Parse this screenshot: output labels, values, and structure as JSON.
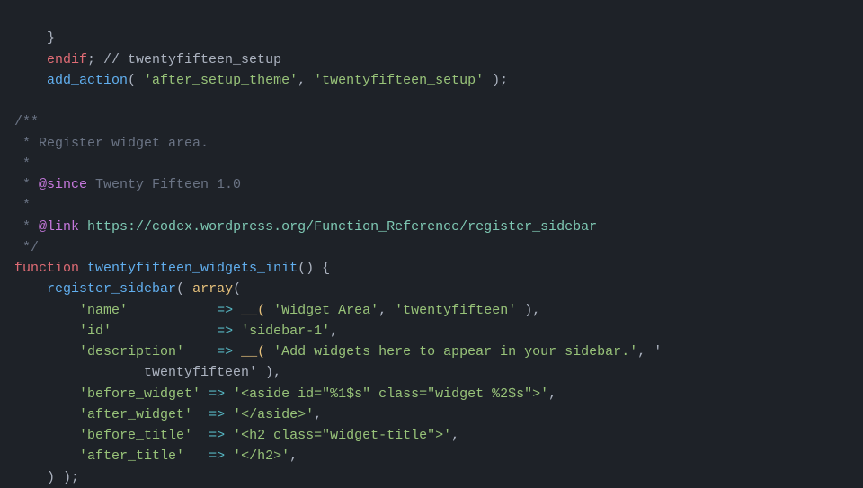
{
  "code": {
    "lines": []
  }
}
